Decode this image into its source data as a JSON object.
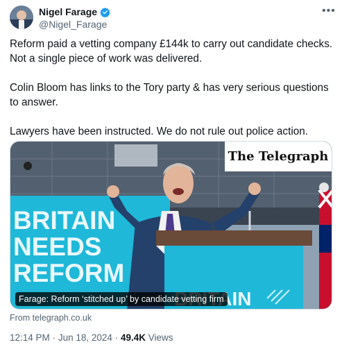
{
  "author": {
    "name": "Nigel Farage",
    "handle": "@Nigel_Farage",
    "verified": true
  },
  "tweet": {
    "paragraphs": [
      "Reform paid a vetting company £144k to carry out candidate checks. Not a single piece of work was delivered.",
      "Colin Bloom has links to the Tory party & has very serious questions to answer.",
      "Lawyers have been instructed. We do not rule out police action."
    ]
  },
  "card": {
    "publisher": "The Telegraph",
    "caption": "Farage: Reform ‘stitched up’ by candidate vetting firm",
    "banner_text": [
      "BRITAIN",
      "NEEDS",
      "REFORM"
    ],
    "lectern_text": "BRITAIN",
    "source": "From telegraph.co.uk"
  },
  "meta": {
    "time": "12:14 PM",
    "date": "Jun 18, 2024",
    "views_count": "49.4K",
    "views_label": "Views",
    "separator": "·"
  },
  "icons": {
    "more": "more-options-icon",
    "verified": "verified-badge-icon"
  },
  "colors": {
    "reform_blue": "#1fb8d8",
    "verified_blue": "#1d9bf0",
    "text_primary": "#0f1419",
    "text_secondary": "#536471"
  }
}
